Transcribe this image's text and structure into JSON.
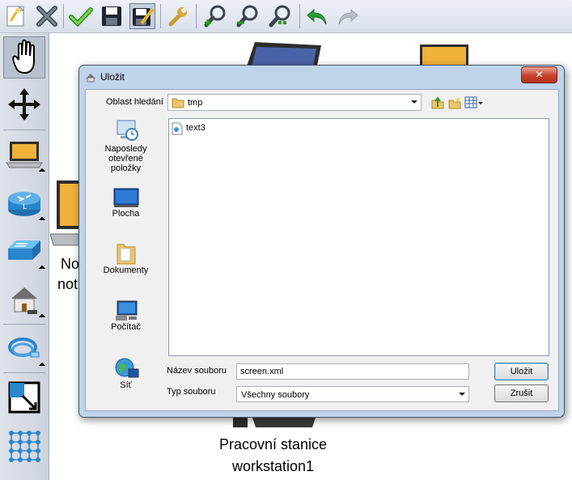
{
  "toolbar": {
    "icons": [
      "new-icon",
      "delete-icon",
      "check-icon",
      "save-icon",
      "save-as-icon",
      "wrench-icon",
      "zoom-in-icon",
      "zoom-out-icon",
      "zoom-fit-icon",
      "undo-icon",
      "redo-icon"
    ]
  },
  "palette": {
    "tools": [
      "hand-tool",
      "move-tool",
      "notebook-device",
      "router-device",
      "switch-device",
      "home-device",
      "cable-device",
      "select-tool",
      "grid-tool"
    ]
  },
  "canvas": {
    "partial_label_1": "No",
    "partial_label_2": "not",
    "workstation_label_1": "Pracovní stanice",
    "workstation_label_2": "workstation1"
  },
  "dialog": {
    "title": "Uložit",
    "close_symbol": "✕",
    "look_in_label": "Oblast hledání",
    "look_in_value": "tmp",
    "places": [
      {
        "label_lines": [
          "Naposledy",
          "otevřené",
          "položky"
        ]
      },
      {
        "label_lines": [
          "Plocha"
        ]
      },
      {
        "label_lines": [
          "Dokumenty"
        ]
      },
      {
        "label_lines": [
          "Počítač"
        ]
      },
      {
        "label_lines": [
          "Síť"
        ]
      }
    ],
    "files": [
      "text3"
    ],
    "filename_label": "Název souboru",
    "filename_value": "screen.xml",
    "filetype_label": "Typ souboru",
    "filetype_value": "Všechny soubory",
    "save_button": "Uložit",
    "cancel_button": "Zrušit"
  }
}
